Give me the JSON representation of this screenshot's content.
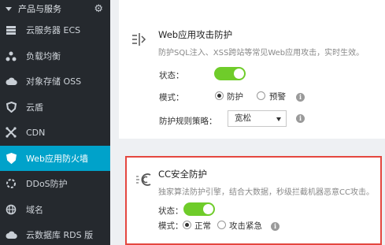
{
  "sidebar": {
    "header": "产品与服务",
    "items": [
      {
        "label": "云服务器 ECS",
        "icon": "server-icon"
      },
      {
        "label": "负载均衡",
        "icon": "load-balancer-icon"
      },
      {
        "label": "对象存储 OSS",
        "icon": "cloud-storage-icon"
      },
      {
        "label": "云盾",
        "icon": "shield-icon"
      },
      {
        "label": "CDN",
        "icon": "cdn-icon"
      },
      {
        "label": "Web应用防火墙",
        "icon": "firewall-icon",
        "active": true
      },
      {
        "label": "DDoS防护",
        "icon": "ddos-icon"
      },
      {
        "label": "域名",
        "icon": "globe-icon"
      },
      {
        "label": "云数据库 RDS 版",
        "icon": "database-icon"
      }
    ]
  },
  "web_attack": {
    "title": "Web应用攻击防护",
    "desc": "防护SQL注入、XSS跨站等常见Web应用攻击，实时生效。",
    "status_label": "状态：",
    "status_on": true,
    "mode_label": "模式：",
    "mode_options": [
      "防护",
      "预警"
    ],
    "mode_selected": "防护",
    "policy_label": "防护规则策略：",
    "policy_value": "宽松"
  },
  "cc_protect": {
    "title": "CC安全防护",
    "desc": "独家算法防护引擎，结合大数据，秒级拦截机器恶意CC攻击。",
    "status_label": "状态：",
    "status_on": true,
    "mode_label": "模式：",
    "mode_options": [
      "正常",
      "攻击紧急"
    ],
    "mode_selected": "正常"
  },
  "colors": {
    "accent": "#00a2ca",
    "toggle_on": "#6fcc2a",
    "highlight_border": "#e4473f",
    "sidebar_bg": "#25292e"
  }
}
